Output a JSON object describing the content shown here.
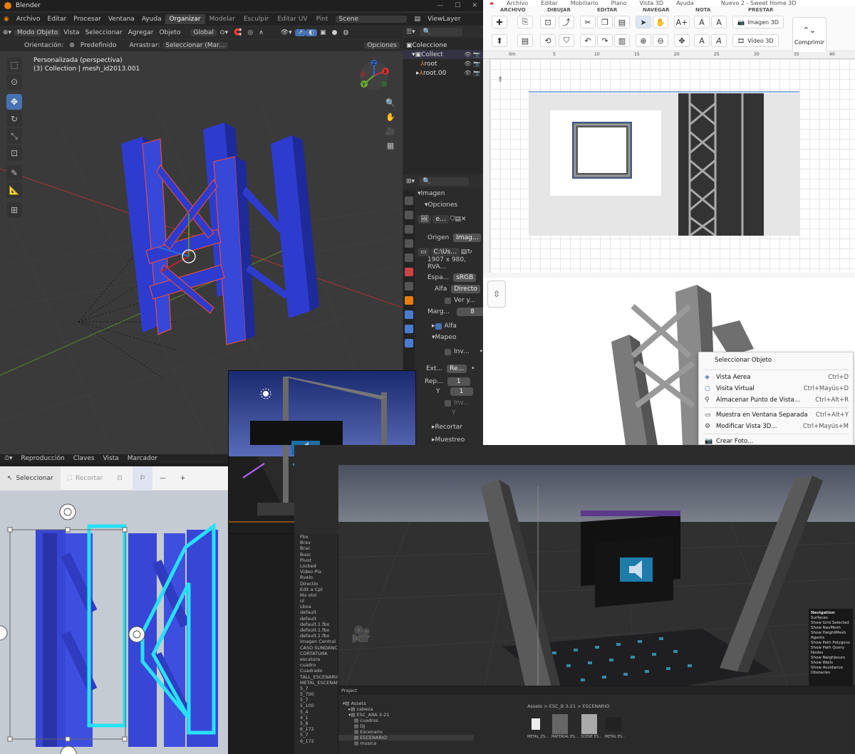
{
  "blender": {
    "app_title": "Blender",
    "menus": [
      "Archivo",
      "Editar",
      "Procesar",
      "Ventana",
      "Ayuda"
    ],
    "workspaces": [
      "Organizar",
      "Modelar",
      "Esculpir",
      "Editar UV",
      "Pint"
    ],
    "scene": "Scene",
    "view_layer": "ViewLayer",
    "header": {
      "mode": "Modo Objeto",
      "vista": "Vista",
      "seleccionar": "Seleccionar",
      "agregar": "Agregar",
      "objeto": "Objeto",
      "transform": "Global"
    },
    "subheader": {
      "orient_label": "Orientación:",
      "orient_value": "Predefinido",
      "drag_label": "Arrastrar:",
      "drag_value": "Seleccionar (Mar...",
      "options": "Opciones"
    },
    "viewport_info": {
      "line1": "Personalizada (perspectiva)",
      "line2": "(3) Collection | mesh_id2013.001"
    },
    "outliner": {
      "title": "Coleccione",
      "rows": [
        "Collect",
        "root",
        "root.00"
      ]
    },
    "properties": {
      "section": "Imagen",
      "options": "Opciones",
      "image_name": "e...",
      "source_label": "Origen",
      "source_value": "Imag...",
      "path": "C:\\Us...",
      "info": "1907 x 980,  RVA...",
      "space_label": "Espa...",
      "space_value": "sRGB",
      "alpha_label": "Alfa",
      "alpha_value": "Directo",
      "ver": "Ver y...",
      "margin_label": "Marg...",
      "margin_value": "8",
      "alfa_panel": "Alfa",
      "mapeo": "Mapeo",
      "inv1": "Inv...",
      "ext_label": "Ext...",
      "ext_value": "Re...",
      "rep_label": "Rep...",
      "rep_x": "1",
      "y_label": "Y",
      "rep_y": "1",
      "inv2": "Inv...",
      "y2": "Y",
      "recortar": "Recortar",
      "muestreo": "Muestreo"
    },
    "timeline": [
      "Reproducción",
      "Claves",
      "Vista",
      "Marcador"
    ]
  },
  "sh3d": {
    "menus": [
      "Archivo",
      "Editar",
      "Mobiliario",
      "Plano",
      "Vista 3D",
      "Ayuda"
    ],
    "title": "Nuevo 2 - Sweet Home 3D",
    "groups": [
      "ARCHIVO",
      "DIBUJAR",
      "EDITAR",
      "NAVEGAR",
      "NOTA",
      "PRESTAR"
    ],
    "imagen3d": "Imagen 3D",
    "video3d": "Vídeo 3D",
    "print": "Comprimir",
    "ruler": [
      "0m",
      "5",
      "10",
      "15",
      "20",
      "25",
      "30",
      "35",
      "40"
    ],
    "context_menu": {
      "title": "Seleccionar Objeto",
      "items": [
        {
          "label": "Vista Aerea",
          "shortcut": "Ctrl+D"
        },
        {
          "label": "Visita Virtual",
          "shortcut": "Ctrl+Mayús+D"
        },
        {
          "label": "Almacenar Punto de Vista...",
          "shortcut": "Ctrl+Alt+R"
        },
        {
          "label": "Muestra en Ventana Separada",
          "shortcut": "Ctrl+Alt+Y"
        },
        {
          "label": "Modificar Vista 3D...",
          "shortcut": "Ctrl+Mayús+M"
        },
        {
          "label": "Crear Foto...",
          "shortcut": ""
        }
      ]
    }
  },
  "paint3d": {
    "select": "Seleccionar",
    "crop": "Recortar",
    "minus": "—",
    "plus": "+"
  },
  "unity": {
    "hierarchy": [
      "Fbx",
      "Brav",
      "Brac",
      "Busc",
      "Pivot",
      "Locked",
      "Video Pla",
      "Rvelo",
      "Directio",
      "Edit a Cpt",
      "Mo olol",
      "nl",
      "Lboa",
      "default",
      "default",
      "default.1.fbx",
      "default.1.fbx",
      "default.1.fbx",
      "imagen Central",
      "CASO SUNDANCE",
      "CORTATURA",
      "escatura",
      "cuadro",
      "Cuadrado",
      "TALL_ESCENARIO",
      "METAL_ESCENARIO",
      "5_7",
      "5_700",
      "5_7",
      "5_100",
      "5_4",
      "4_1",
      "5_8",
      "6_172",
      "5_7",
      "6_172"
    ],
    "overlay_title": "Navigation",
    "overlay": [
      "Surfaces",
      "Show Grid Selected",
      "Show NavMesh",
      "Show HeightMesh",
      "",
      "Agents",
      "Show Path Polygons",
      "Show Path Query Nodes",
      "Show Neighbours",
      "Show Walls",
      "Show Avoidance",
      "",
      "Obstacles"
    ],
    "project_tab": "Project",
    "breadcrumb": "Assets > ESC_B 3-21 > ESCENARIO",
    "tree": [
      "Assets",
      "cabeza",
      "ESC_ARA 3-21",
      "cuadros",
      "DJ",
      "Escenario",
      "ESCENARIO",
      "musica"
    ],
    "assets": [
      "METAL_ES...",
      "MATERIAL ES...",
      "SCENE ES...",
      "METAL ES..."
    ]
  }
}
